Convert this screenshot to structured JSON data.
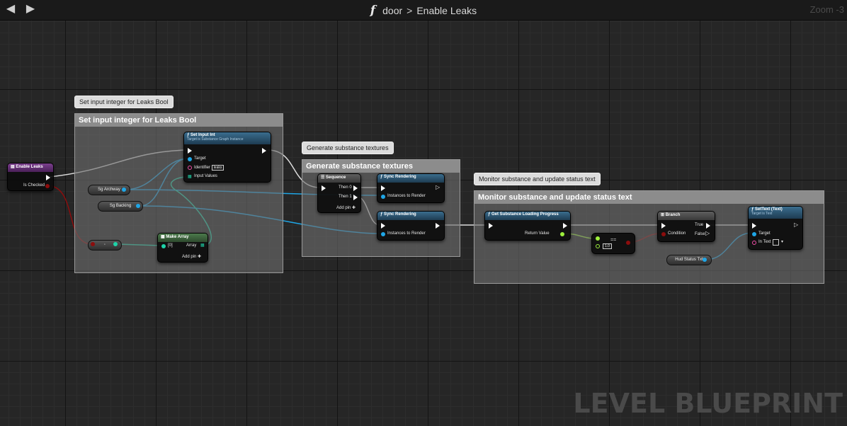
{
  "header": {
    "function_symbol": "f",
    "breadcrumb_parent": "door",
    "breadcrumb_separator": ">",
    "breadcrumb_current": "Enable Leaks",
    "zoom_label": "Zoom -3",
    "back_icon": "back-arrow-icon",
    "forward_icon": "forward-arrow-icon"
  },
  "watermark": "LEVEL BLUEPRINT",
  "comments": [
    {
      "bubble": "Set input integer for Leaks Bool",
      "title": "Set input integer for Leaks Bool"
    },
    {
      "bubble": "Generate substance textures",
      "title": "Generate substance textures"
    },
    {
      "bubble": "Monitor substance and update status text",
      "title": "Monitor substance and update status text"
    }
  ],
  "nodes": {
    "enable_leaks": {
      "title": "Enable Leaks",
      "pin_is_checked": "Is Checked"
    },
    "set_input_int": {
      "title": "Set Input Int",
      "subtitle": "Target is Substance Graph Instance",
      "pin_target": "Target",
      "pin_identifier": "Identifier",
      "identifier_value": "leaks",
      "pin_input_values": "Input Values"
    },
    "sg_archway": {
      "label": "Sg Archway"
    },
    "sg_backing": {
      "label": "Sg Backing"
    },
    "select_float": {
      "label": "◦"
    },
    "make_array": {
      "title": "Make Array",
      "pin_0": "[0]",
      "pin_array": "Array",
      "add_pin": "Add pin"
    },
    "sequence": {
      "title": "Sequence",
      "then0": "Then 0",
      "then1": "Then 1",
      "add_pin": "Add pin"
    },
    "sync_rendering_1": {
      "title": "Sync Rendering",
      "pin_instances": "Instances to Render"
    },
    "sync_rendering_2": {
      "title": "Sync Rendering",
      "pin_instances": "Instances to Render"
    },
    "get_progress": {
      "title": "Get Substance Loading Progress",
      "pin_return": "Return Value"
    },
    "compare": {
      "op": "==",
      "value": "1.0"
    },
    "branch": {
      "title": "Branch",
      "pin_condition": "Condition",
      "pin_true": "True",
      "pin_false": "False"
    },
    "hud_status_txt": {
      "label": "Hud Status Txt"
    },
    "set_text": {
      "title": "SetText (Text)",
      "subtitle": "Target is Text",
      "pin_target": "Target",
      "pin_in_text": "In Text"
    }
  },
  "colors": {
    "exec": "#ffffff",
    "object_pin": "#1fa6e6",
    "bool_pin": "#8c0d0d",
    "float_pin": "#9ef03c",
    "int_pin": "#1ed3a8",
    "string_pin": "#f24ea8"
  }
}
